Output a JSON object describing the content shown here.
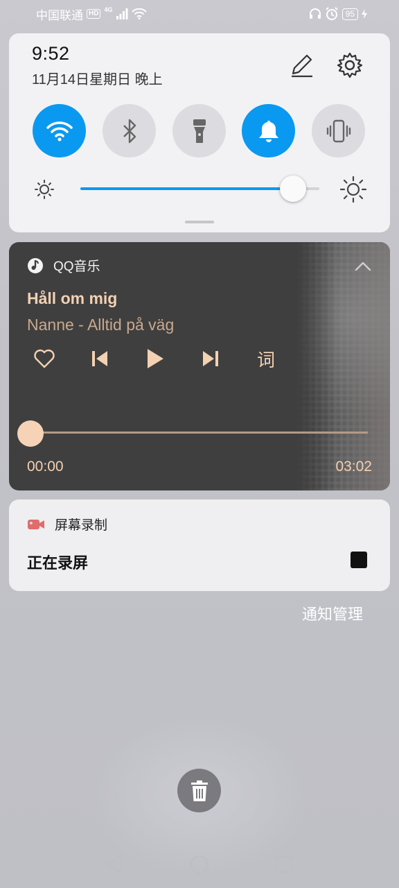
{
  "status_bar": {
    "carrier": "中国联通",
    "hd": "HD",
    "network": "4G",
    "battery": "95"
  },
  "quick_panel": {
    "time": "9:52",
    "date": "11月14日星期日 晚上",
    "toggles": [
      {
        "name": "wifi",
        "state": "on"
      },
      {
        "name": "bluetooth",
        "state": "off"
      },
      {
        "name": "flashlight",
        "state": "off"
      },
      {
        "name": "sound",
        "state": "on"
      },
      {
        "name": "vibrate",
        "state": "off"
      }
    ],
    "brightness_level": 0.89,
    "accent_color": "#0a99f0"
  },
  "music": {
    "app_name": "QQ音乐",
    "title": "Håll om mig",
    "artist": "Nanne - Alltid på väg",
    "lyric_label": "词",
    "current_time": "00:00",
    "total_time": "03:02",
    "progress": 0.0
  },
  "screen_record": {
    "app_name": "屏幕录制",
    "status": "正在录屏"
  },
  "notification_manage": "通知管理"
}
